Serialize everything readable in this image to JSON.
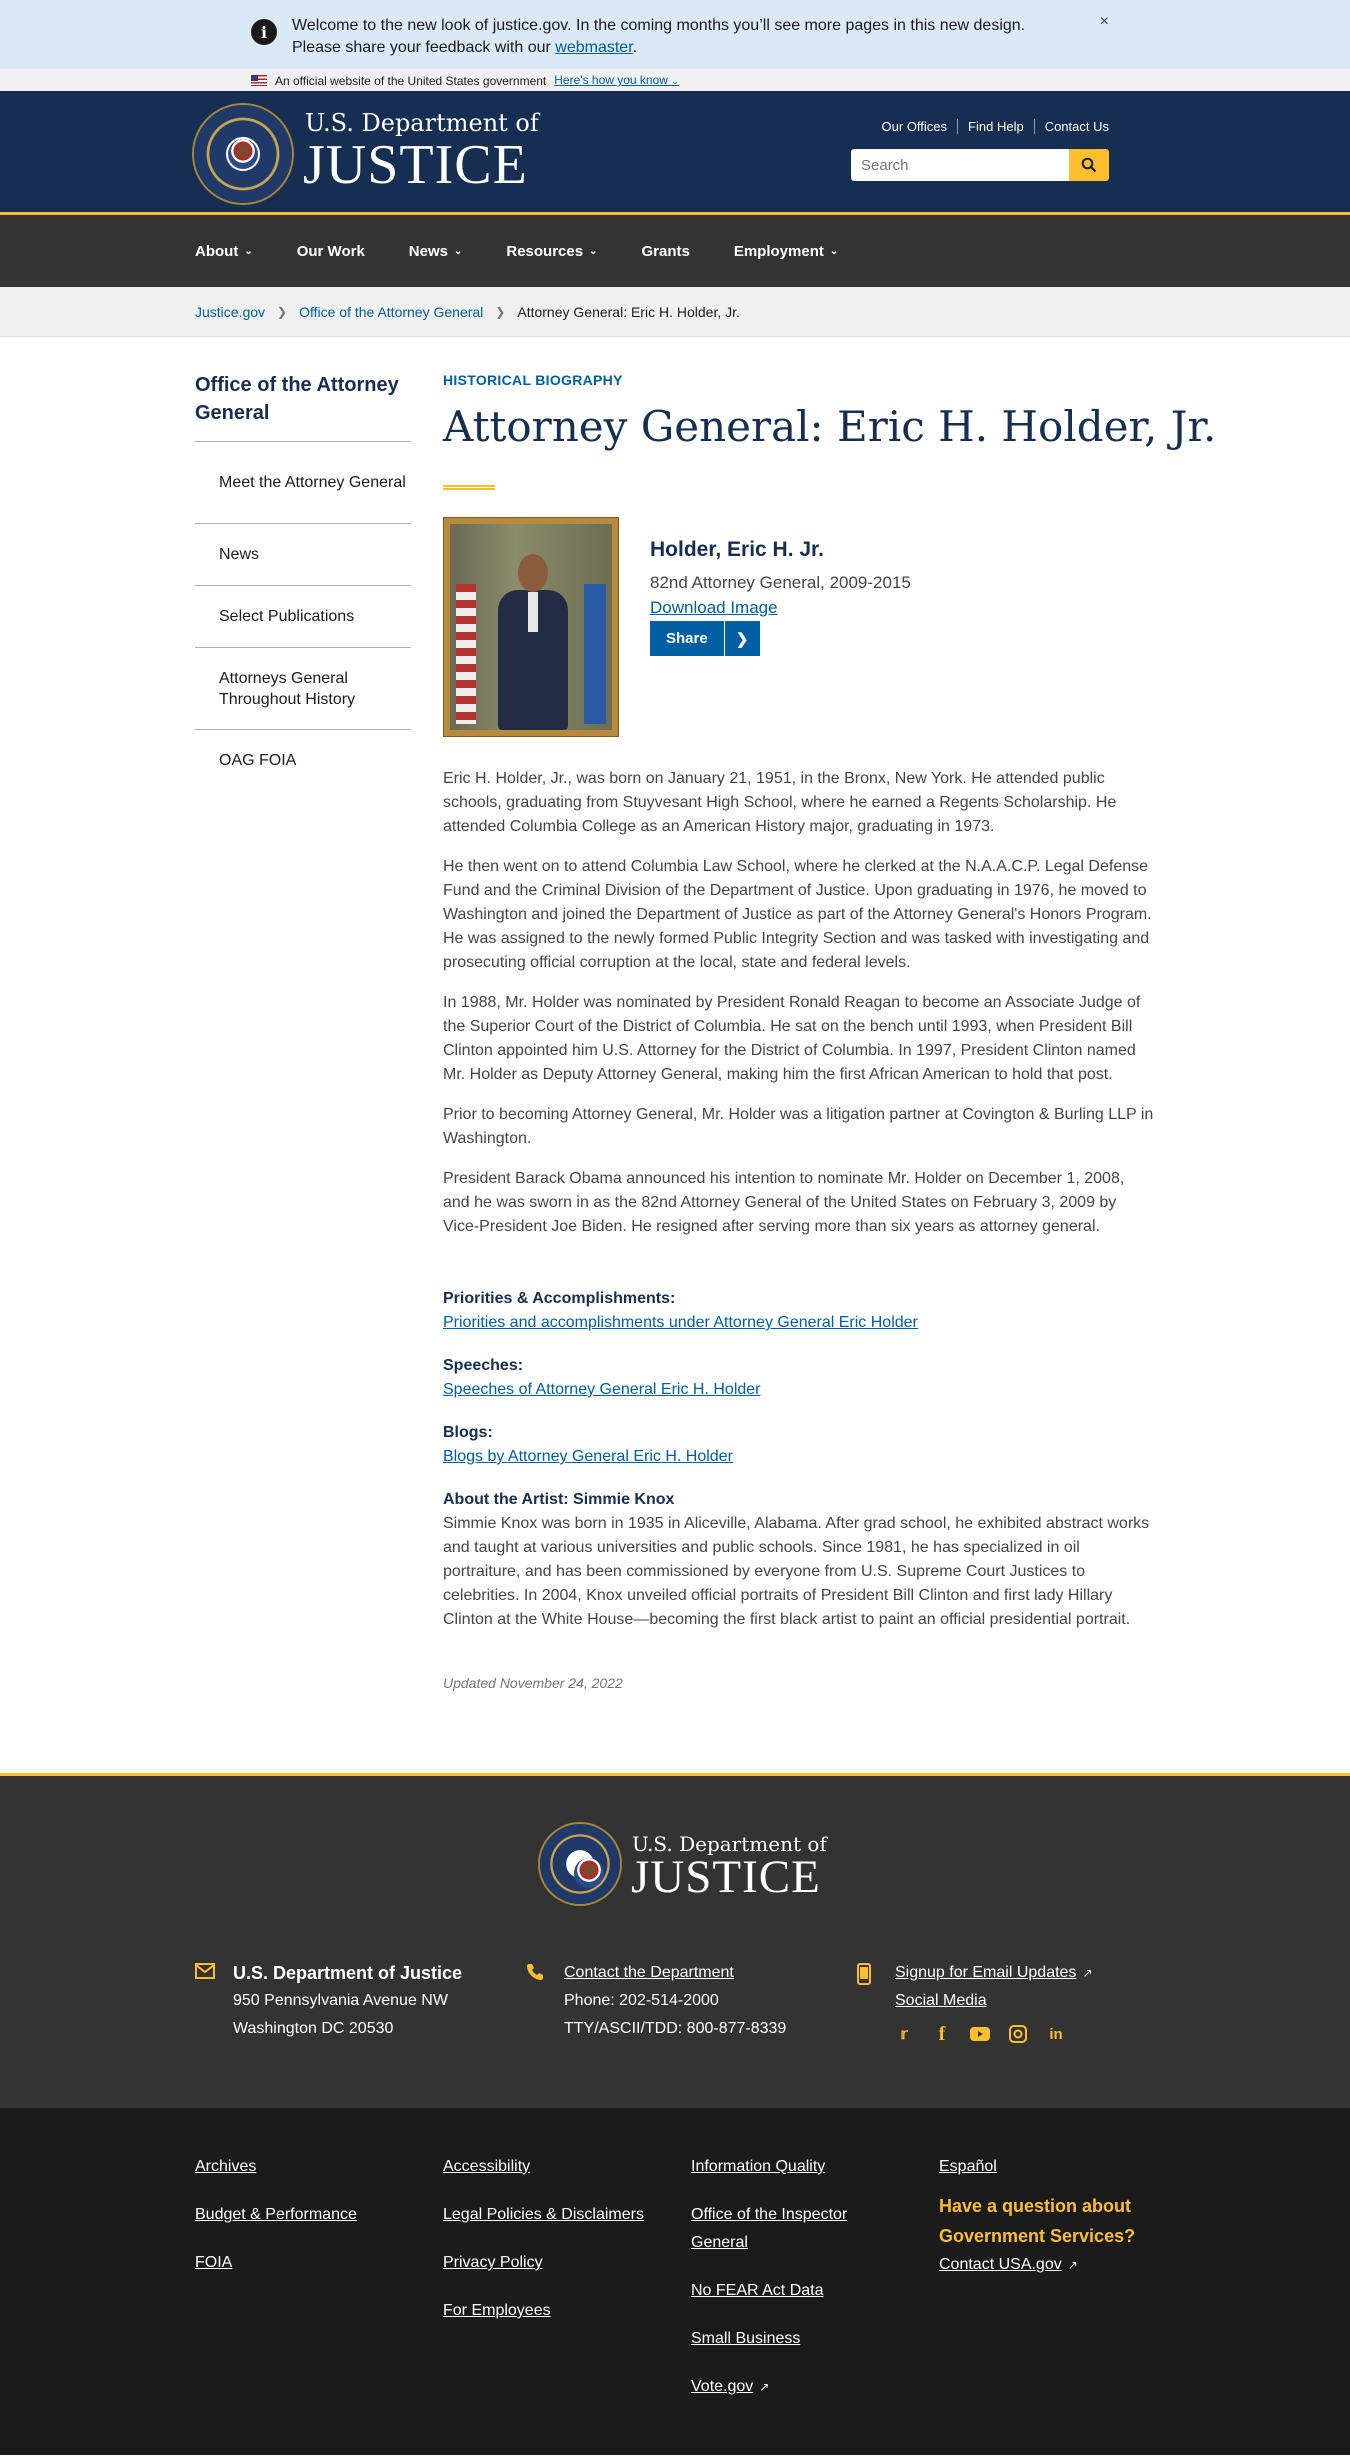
{
  "alert": {
    "text": "Welcome to the new look of justice.gov. In the coming months you’ll see more pages in this new design. Please share your feedback with our ",
    "link": "webmaster",
    "end": ".",
    "close": "×"
  },
  "gov_banner": {
    "text": "An official website of the United States government",
    "link": "Here's how you know"
  },
  "header": {
    "logo_top": "U.S. Department of",
    "logo_main": "JUSTICE",
    "util_links": [
      "Our Offices",
      "Find Help",
      "Contact Us"
    ],
    "search_placeholder": "Search"
  },
  "nav": {
    "items": [
      "About",
      "Our Work",
      "News",
      "Resources",
      "Grants",
      "Employment"
    ]
  },
  "breadcrumb": [
    "Justice.gov",
    "Office of the Attorney General",
    "Attorney General: Eric H. Holder, Jr."
  ],
  "sidebar": {
    "title": "Office of the Attorney General",
    "items": [
      "Meet the Attorney General",
      "News",
      "Select Publications",
      "Attorneys General Throughout History",
      "OAG FOIA"
    ]
  },
  "content": {
    "eyebrow": "HISTORICAL BIOGRAPHY",
    "title": "Attorney General: Eric H. Holder, Jr.",
    "card": {
      "name": "Holder, Eric H. Jr.",
      "subtitle": "82nd Attorney General, 2009-2015",
      "download": "Download Image",
      "share": "Share"
    },
    "paragraphs": [
      "Eric H. Holder, Jr., was born on January 21, 1951, in the Bronx, New York. He attended public schools, graduating from Stuyvesant High School, where he earned a Regents Scholarship. He attended Columbia College as an American History major, graduating in 1973.",
      "He then went on to attend Columbia Law School, where he clerked at the N.A.A.C.P. Legal Defense Fund and the Criminal Division of the Department of Justice. Upon graduating in 1976, he moved to Washington and joined the Department of Justice as part of the Attorney General's Honors Program. He was assigned to the newly formed Public Integrity Section and was tasked with investigating and prosecuting official corruption at the local, state and federal levels.",
      "In 1988, Mr. Holder was nominated by President Ronald Reagan to become an Associate Judge of the Superior Court of the District of Columbia. He sat on the bench until 1993, when President Bill Clinton appointed him U.S. Attorney for the District of Columbia. In 1997, President Clinton named Mr. Holder as Deputy Attorney General, making him the first African American to hold that post.",
      "Prior to becoming Attorney General, Mr. Holder was a litigation partner at Covington & Burling LLP in Washington.",
      "President Barack Obama announced his intention to nominate Mr. Holder on December 1, 2008, and he was sworn in as the 82nd Attorney General of the United States on February 3, 2009 by Vice-President Joe Biden. He resigned after serving more than six years as attorney general."
    ],
    "sections": [
      {
        "label": "Priorities & Accomplishments:",
        "link": "Priorities and accomplishments under Attorney General Eric Holder"
      },
      {
        "label": "Speeches:",
        "link": "Speeches of Attorney General Eric H. Holder"
      },
      {
        "label": "Blogs:",
        "link": "Blogs by Attorney General Eric H. Holder"
      }
    ],
    "artist_label": "About the Artist: Simmie Knox",
    "artist_text": "Simmie Knox was born in 1935 in Aliceville, Alabama. After grad school, he exhibited abstract works and taught at various universities and public schools. Since 1981, he has specialized in oil portraiture, and has been commissioned by everyone from U.S. Supreme Court Justices to celebrities. In 2004, Knox unveiled official portraits of President Bill Clinton and first lady Hillary Clinton at the White House—becoming the first black artist to paint an official presidential portrait.",
    "updated": "Updated November 24, 2022"
  },
  "footer": {
    "logo_top": "U.S. Department of",
    "logo_main": "JUSTICE",
    "address_title": "U.S. Department of Justice",
    "address_1": "950 Pennsylvania Avenue NW",
    "address_2": "Washington DC 20530",
    "contact_link": "Contact the Department",
    "phone": "Phone: 202-514-2000",
    "tty": "TTY/ASCII/TDD: 800-877-8339",
    "email_link": "Signup for Email Updates",
    "social_link": "Social Media",
    "social_icons": [
      "twitter-icon",
      "facebook-icon",
      "youtube-icon",
      "instagram-icon",
      "linkedin-icon"
    ]
  },
  "bottom": {
    "col1": [
      "Archives",
      "Budget & Performance",
      "FOIA"
    ],
    "col2": [
      "Accessibility",
      "Legal Policies & Disclaimers",
      "Privacy Policy",
      "For Employees"
    ],
    "col3": [
      "Information Quality",
      "Office of the Inspector General",
      "No FEAR Act Data",
      "Small Business",
      "Vote.gov"
    ],
    "espanol": "Español",
    "question": "Have a question about Government Services?",
    "usa": "Contact USA.gov"
  },
  "colors": {
    "navy": "#162e51",
    "gold": "#ffbe2e",
    "link": "#005ea2",
    "nav_bg": "#333333"
  }
}
